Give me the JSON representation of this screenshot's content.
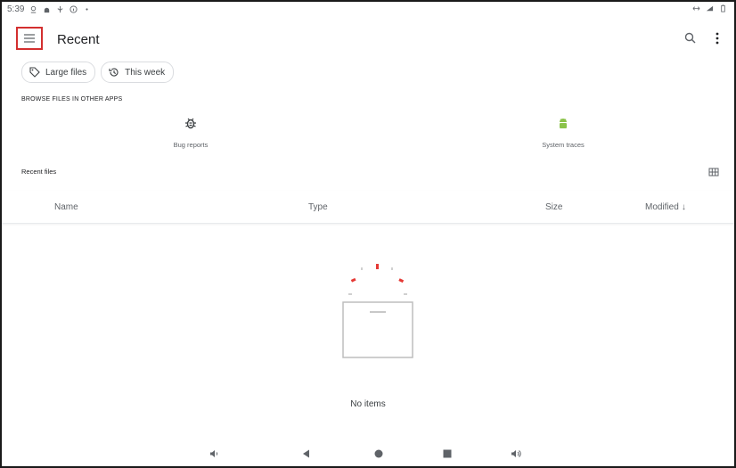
{
  "status_bar": {
    "time": "5:39"
  },
  "app_bar": {
    "title": "Recent"
  },
  "chips": [
    {
      "label": "Large files",
      "icon": "tag-icon"
    },
    {
      "label": "This week",
      "icon": "history-icon"
    }
  ],
  "browse_section": {
    "heading": "BROWSE FILES IN OTHER APPS",
    "apps": [
      {
        "label": "Bug reports",
        "icon": "bug-icon",
        "color": "#3c4043"
      },
      {
        "label": "System traces",
        "icon": "android-icon",
        "color": "#8bc34a"
      }
    ]
  },
  "recent_files": {
    "heading": "Recent files",
    "columns": {
      "name": "Name",
      "type": "Type",
      "size": "Size",
      "modified": "Modified"
    },
    "sort_indicator": "↓",
    "empty_text": "No items"
  },
  "colors": {
    "highlight": "#d32f2f",
    "accent_red": "#e53935"
  }
}
